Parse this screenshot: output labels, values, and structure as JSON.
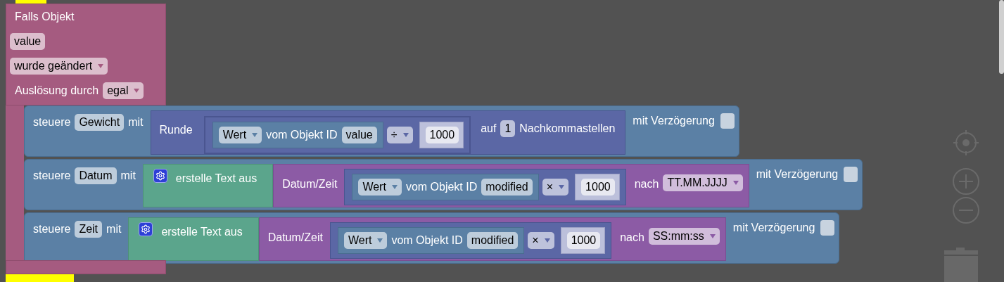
{
  "event_block": {
    "title": "Falls Objekt",
    "object_id": "value",
    "condition": "wurde geändert",
    "trigger_label": "Auslösung durch",
    "trigger": "egal"
  },
  "statements": [
    {
      "label": "steuere",
      "target": "Gewicht",
      "with_label": "mit",
      "delay_label": "mit Verzögerung",
      "delay": false,
      "value": {
        "kind": "round",
        "label": "Runde",
        "operand": {
          "property": "Wert",
          "label": "vom Objekt ID",
          "object_id": "value",
          "operator": "÷",
          "number": "1000"
        },
        "places_prefix": "auf",
        "places": "1",
        "places_suffix": "Nachkommastellen"
      }
    },
    {
      "label": "steuere",
      "target": "Datum",
      "with_label": "mit",
      "delay_label": "mit Verzögerung",
      "delay": false,
      "value": {
        "kind": "text_join",
        "label": "erstelle Text aus",
        "item": {
          "kind": "date_format",
          "label": "Datum/Zeit",
          "operand": {
            "property": "Wert",
            "label": "vom Objekt ID",
            "object_id": "modified",
            "operator": "×",
            "number": "1000"
          },
          "format_label": "nach",
          "format": "TT.MM.JJJJ"
        }
      }
    },
    {
      "label": "steuere",
      "target": "Zeit",
      "with_label": "mit",
      "delay_label": "mit Verzögerung",
      "delay": false,
      "value": {
        "kind": "text_join",
        "label": "erstelle Text aus",
        "item": {
          "kind": "date_format",
          "label": "Datum/Zeit",
          "operand": {
            "property": "Wert",
            "label": "vom Objekt ID",
            "object_id": "modified",
            "operator": "×",
            "number": "1000"
          },
          "format_label": "nach",
          "format": "SS:mm:ss"
        }
      }
    }
  ]
}
